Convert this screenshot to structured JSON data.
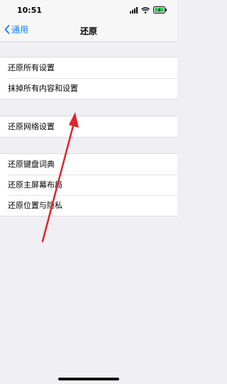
{
  "status": {
    "time": "10:51"
  },
  "nav": {
    "back_label": "通用",
    "title": "还原"
  },
  "groups": [
    {
      "items": [
        {
          "label": "还原所有设置"
        },
        {
          "label": "抹掉所有内容和设置"
        }
      ]
    },
    {
      "items": [
        {
          "label": "还原网络设置"
        }
      ]
    },
    {
      "items": [
        {
          "label": "还原键盘词典"
        },
        {
          "label": "还原主屏幕布局"
        },
        {
          "label": "还原位置与隐私"
        }
      ]
    }
  ],
  "colors": {
    "accent": "#1a7cf5",
    "annotation_arrow": "#e0242b",
    "background": "#efeff4"
  },
  "icons": [
    "signal-icon",
    "wifi-icon",
    "battery-charging-icon",
    "chevron-left-icon",
    "red-arrow-annotation"
  ]
}
